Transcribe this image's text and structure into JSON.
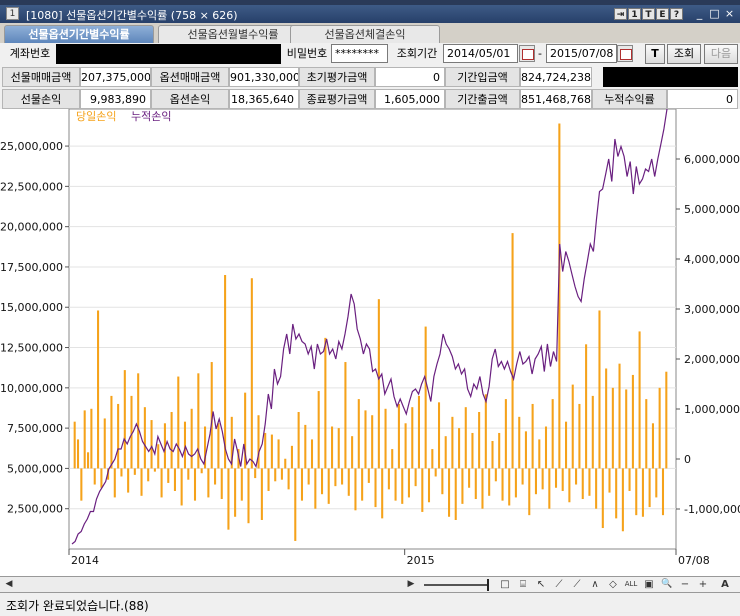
{
  "window": {
    "screen_no": "[1080]",
    "title": "선물옵션기간별수익률",
    "size_text": "(758 × 626)",
    "title_buttons": [
      "⇥",
      "1",
      "T",
      "E",
      "?"
    ],
    "win_controls": {
      "minimize": "_",
      "maximize": "□",
      "close": "×"
    }
  },
  "tabs": [
    {
      "label": "선물옵션기간별수익률",
      "active": true
    },
    {
      "label": "선물옵션월별수익률",
      "active": false
    },
    {
      "label": "선물옵션체결손익",
      "active": false
    }
  ],
  "query": {
    "account_label": "계좌번호",
    "password_label": "비밀번호",
    "password_value": "********",
    "period_label": "조회기간",
    "start_date": "2014/05/01",
    "separator": "-",
    "end_date": "2015/07/08",
    "t_button": "T",
    "search_button": "조회",
    "next_button": "다음"
  },
  "summary_row1": [
    {
      "label": "선물매매금액",
      "value": "207,375,000"
    },
    {
      "label": "옵션매매금액",
      "value": "901,330,000"
    },
    {
      "label": "초기평가금액",
      "value": "0"
    },
    {
      "label": "기간입금액",
      "value": "824,724,238"
    }
  ],
  "summary_row2": [
    {
      "label": "선물손익",
      "value": "9,983,890"
    },
    {
      "label": "옵션손익",
      "value": "18,365,640"
    },
    {
      "label": "종료평가금액",
      "value": "1,605,000"
    },
    {
      "label": "기간출금액",
      "value": "851,468,768"
    },
    {
      "label": "누적수익률",
      "value": "0"
    }
  ],
  "chart_data": {
    "type": "bar+line",
    "legend": [
      {
        "name": "당일손익",
        "color": "#f5a21a"
      },
      {
        "name": "누적손익",
        "color": "#6a2080"
      }
    ],
    "legend_position": "top-left",
    "grid": true,
    "left_axis": {
      "ticks": [
        "2,500,000",
        "5,000,000",
        "7,500,000",
        "10,000,000",
        "12,500,000",
        "15,000,000",
        "17,500,000",
        "20,000,000",
        "22,500,000",
        "25,000,000"
      ],
      "tick_values": [
        2500000,
        5000000,
        7500000,
        10000000,
        12500000,
        15000000,
        17500000,
        20000000,
        22500000,
        25000000
      ],
      "range": [
        0,
        27300000
      ],
      "baseline": 5000000
    },
    "right_axis": {
      "ticks": [
        "-1,000,000",
        "0",
        "1,000,000",
        "2,000,000",
        "3,000,000",
        "4,000,000",
        "5,000,000",
        "6,000,000"
      ],
      "tick_values": [
        -1000000,
        0,
        1000000,
        2000000,
        3000000,
        4000000,
        5000000,
        6000000
      ],
      "range": [
        -1800000,
        7000000
      ]
    },
    "x_axis": {
      "labels": [
        {
          "text": "2014",
          "pos": 0.0
        },
        {
          "text": "2015",
          "pos": 0.553
        },
        {
          "text": "07/08",
          "pos": 1.0
        }
      ]
    },
    "series": [
      {
        "name": "당일손익",
        "axis": "left",
        "values": [
          7900000,
          6800000,
          3000000,
          8600000,
          6000000,
          8700000,
          4000000,
          14800000,
          3800000,
          8100000,
          4300000,
          9500000,
          3200000,
          9000000,
          4500000,
          11100000,
          3500000,
          9500000,
          4600000,
          10900000,
          3300000,
          8800000,
          4200000,
          8000000,
          4800000,
          6500000,
          3200000,
          7800000,
          4100000,
          8500000,
          3600000,
          10700000,
          2700000,
          7900000,
          4300000,
          8700000,
          3000000,
          10900000,
          4700000,
          7600000,
          3200000,
          11600000,
          4000000,
          7800000,
          3100000,
          17000000,
          1200000,
          8200000,
          2000000,
          6200000,
          3000000,
          9700000,
          1600000,
          16800000,
          4400000,
          8300000,
          1800000,
          7200000,
          3600000,
          7100000,
          4200000,
          6800000,
          4300000,
          5600000,
          3700000,
          6400000,
          500000,
          8500000,
          3000000,
          7700000,
          4000000,
          6800000,
          2500000,
          9800000,
          3400000,
          13100000,
          2800000,
          7600000,
          3900000,
          7500000,
          4000000,
          11600000,
          3300000,
          7000000,
          2400000,
          9300000,
          3000000,
          8600000,
          4100000,
          8300000,
          2600000,
          15500000,
          1900000,
          8700000,
          3700000,
          6200000,
          3000000,
          9000000,
          2800000,
          7800000,
          3200000,
          8800000,
          3900000,
          9500000,
          2300000,
          13800000,
          2900000,
          6200000,
          4500000,
          9100000,
          3400000,
          7000000,
          2000000,
          8200000,
          1800000,
          7500000,
          2800000,
          8800000,
          3800000,
          7200000,
          3100000,
          8500000,
          2500000,
          9600000,
          3300000,
          6700000,
          4200000,
          7200000,
          3000000,
          9300000,
          2700000,
          19600000,
          3200000,
          8200000,
          4000000,
          7300000,
          2100000,
          9000000,
          3400000,
          6800000,
          3700000,
          7600000,
          2500000,
          9300000,
          3800000,
          26400000,
          3600000,
          7900000,
          2900000,
          10200000,
          4000000,
          9000000,
          3100000,
          12700000,
          3300000,
          9500000,
          2500000,
          14800000,
          1300000,
          11200000,
          3500000,
          10000000,
          1900000,
          11500000,
          1100000,
          9900000,
          3600000,
          10800000,
          2100000,
          13500000,
          2000000,
          9300000,
          2600000,
          7800000,
          3200000,
          10000000,
          2100000,
          11000000
        ]
      },
      {
        "name": "누적손익",
        "axis": "right",
        "values": [
          -1700000,
          -1650000,
          -1500000,
          -1450000,
          -1300000,
          -1200000,
          -1050000,
          -1050000,
          -800000,
          -650000,
          -550000,
          -450000,
          -200000,
          -100000,
          0,
          200000,
          200000,
          400000,
          300000,
          450000,
          550000,
          700000,
          550000,
          350000,
          250000,
          150000,
          250000,
          100000,
          450000,
          300000,
          150000,
          350000,
          200000,
          150000,
          300000,
          200000,
          50000,
          250000,
          100000,
          50000,
          100000,
          200000,
          0,
          -100000,
          200000,
          500000,
          950000,
          600000,
          800000,
          550000,
          200000,
          0,
          -100000,
          400000,
          150000,
          -150000,
          300000,
          -100000,
          0,
          -50000,
          -150000,
          150000,
          300000,
          700000,
          1300000,
          1000000,
          1800000,
          1500000,
          1650000,
          2200000,
          2500000,
          2100000,
          2700000,
          2400000,
          2500000,
          2350000,
          2300000,
          2100000,
          2250000,
          1800000,
          2300000,
          2100000,
          2150000,
          2400000,
          2100000,
          2200000,
          2000000,
          2350000,
          2200000,
          2500000,
          2850000,
          3300000,
          3100000,
          2600000,
          2400000,
          2100000,
          2300000,
          2200000,
          1750000,
          1800000,
          1600000,
          1700000,
          1300000,
          1450000,
          1600000,
          1250000,
          1050000,
          1200000,
          1050000,
          900000,
          1150000,
          1350000,
          1400000,
          1300000,
          1500000,
          1650000,
          1400000,
          1150000,
          1650000,
          1900000,
          2100000,
          2500000,
          2300000,
          2200000,
          2050000,
          1800000,
          1900000,
          1700000,
          1800000,
          1400000,
          1250000,
          1500000,
          1400000,
          1650000,
          1300000,
          1150000,
          1450000,
          2000000,
          2200000,
          1850000,
          1950000,
          1800000,
          1950000,
          1750000,
          1600000,
          1900000,
          2150000,
          1900000,
          1950000,
          2050000,
          1700000,
          2000000,
          2100000,
          2250000,
          1750000,
          2300000,
          1850000,
          2150000,
          1950000,
          4300000,
          3750000,
          4150000,
          3950000,
          3700000,
          3450000,
          3250000,
          3150000,
          3600000,
          3950000,
          4300000,
          4150000,
          4800000,
          5350000,
          5400000,
          5700000,
          6000000,
          5550000,
          6400000,
          6050000,
          6250000,
          6050000,
          5650000,
          5950000,
          5300000,
          5850000,
          5500000,
          5600000,
          5800000,
          5750000,
          6000000,
          5650000,
          6000000,
          6300000,
          6600000,
          7000000
        ]
      }
    ]
  },
  "bottom_toolbar": {
    "tools": [
      "□",
      "⌸",
      "↖",
      "⟋",
      "⟋",
      "∧",
      "◇",
      "ALL",
      "▣",
      "🔍",
      "−",
      "+",
      "A"
    ]
  },
  "status": {
    "message": "조회가 완료되었습니다.(88)"
  },
  "colors": {
    "bar": "#f5a21a",
    "line": "#6a2080",
    "titlebar": "#2f4a76",
    "tab_active": "#6b91c4"
  }
}
